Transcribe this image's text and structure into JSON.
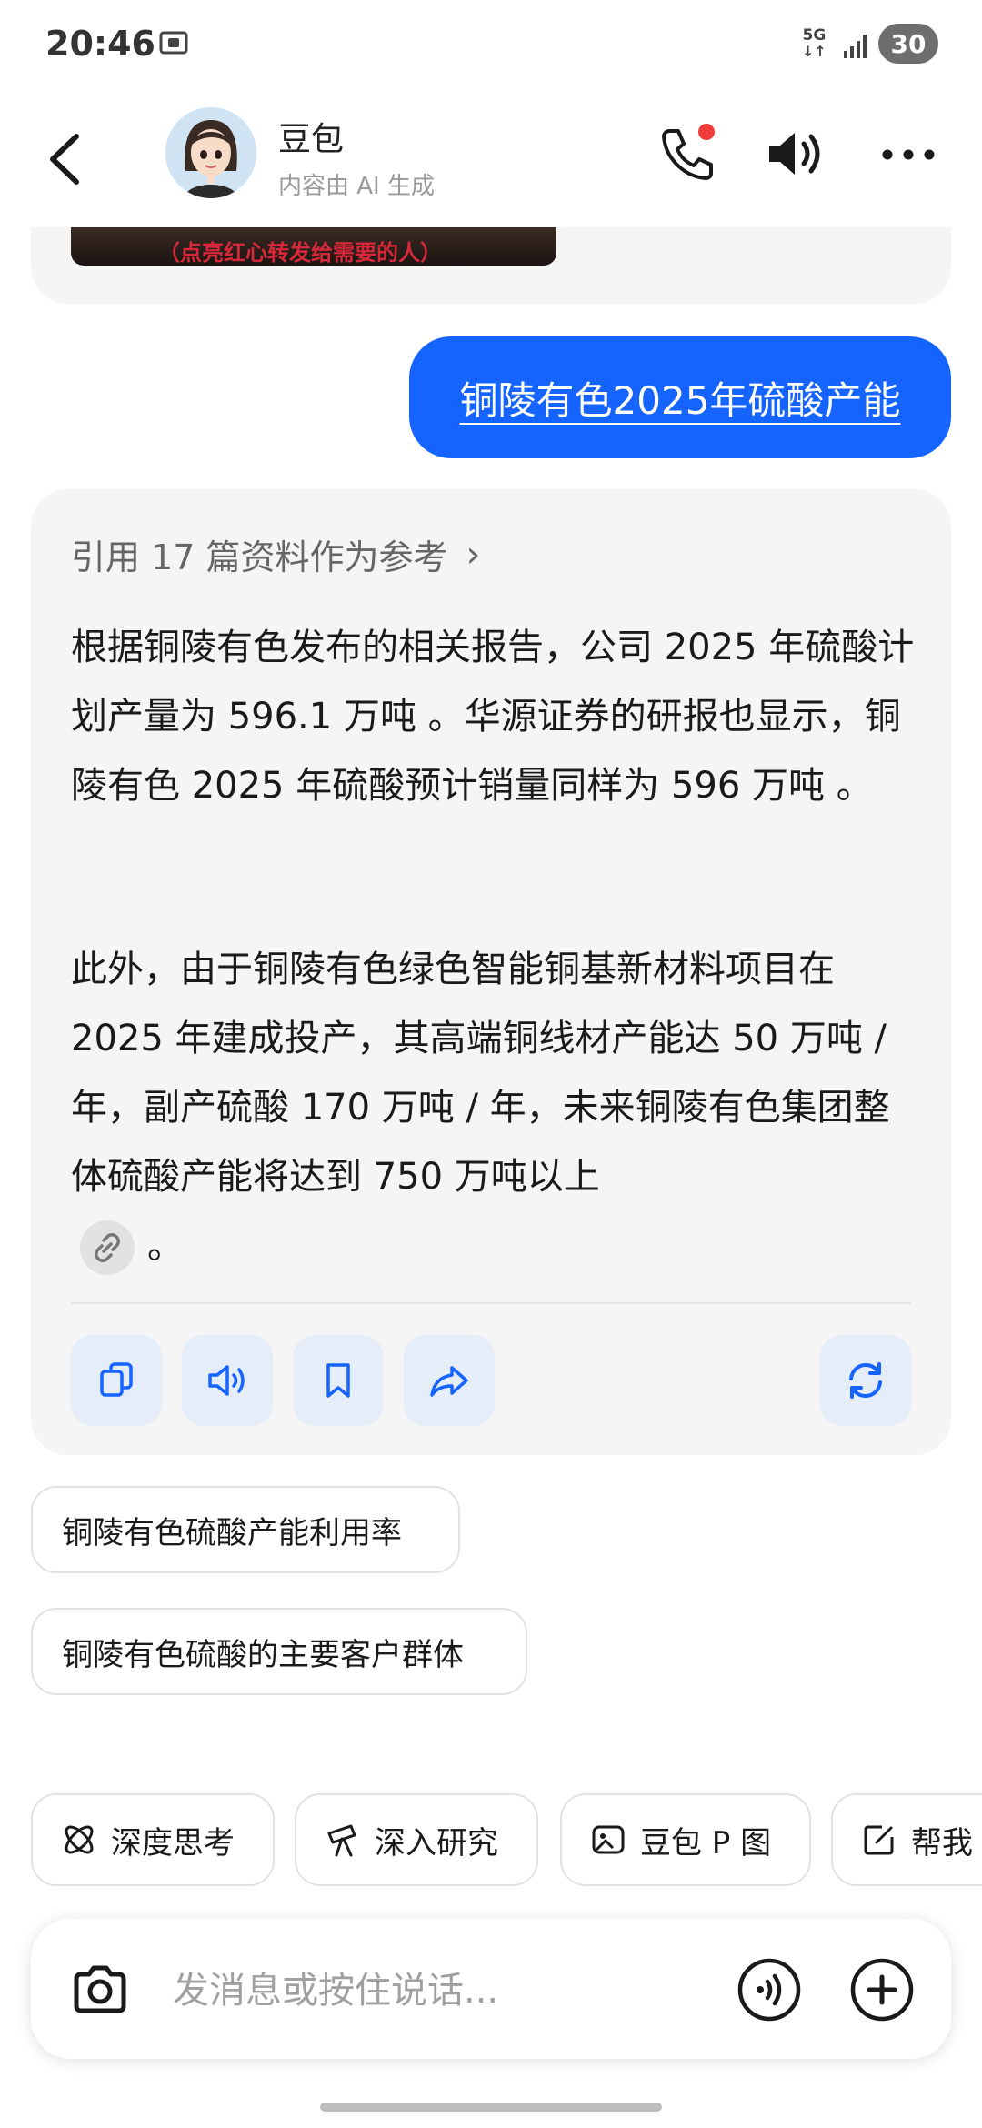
{
  "status_bar": {
    "time": "20:46",
    "network": "5G",
    "battery": "30",
    "icons": [
      "screenshot-icon",
      "signal-icon"
    ]
  },
  "header": {
    "title": "豆包",
    "subtitle": "内容由 AI 生成",
    "icons": [
      "back-icon",
      "phone-icon",
      "speaker-icon",
      "more-icon"
    ],
    "call_badge_color": "#f03b3b"
  },
  "previous_message": {
    "thumbnail_caption": "（点亮红心转发给需要的人）"
  },
  "user_message": {
    "text": "铜陵有色2025年硫酸产能"
  },
  "answer": {
    "references_label": "引用 17 篇资料作为参考",
    "paragraph_1": "根据铜陵有色发布的相关报告，公司 2025 年硫酸计划产量为 596.1 万吨 。华源证券的研报也显示，铜陵有色 2025 年硫酸预计销量同样为 596 万吨 。",
    "paragraph_2_main": "此外，由于铜陵有色绿色智能铜基新材料项目在 2025 年建成投产，其高端铜线材产能达 50 万吨 / 年，副产硫酸 170 万吨 / 年，未来铜陵有色集团整体硫酸产能将达到 750 万吨以上",
    "paragraph_2_end": "。",
    "actions": [
      "copy-icon",
      "read-aloud-icon",
      "bookmark-icon",
      "share-icon",
      "regenerate-icon"
    ]
  },
  "suggestions": [
    "铜陵有色硫酸产能利用率",
    "铜陵有色硫酸的主要客户群体"
  ],
  "tools": [
    {
      "label": "深度思考",
      "icon": "atom-icon"
    },
    {
      "label": "深入研究",
      "icon": "telescope-icon"
    },
    {
      "label": "豆包 P 图",
      "icon": "image-edit-icon"
    },
    {
      "label": "帮我",
      "icon": "edit-icon"
    }
  ],
  "input": {
    "placeholder": "发消息或按住说话..."
  },
  "colors": {
    "accent": "#1664ff",
    "card_bg": "#f5f5f5",
    "action_bg": "#e4edf8",
    "action_icon": "#1664ff"
  }
}
